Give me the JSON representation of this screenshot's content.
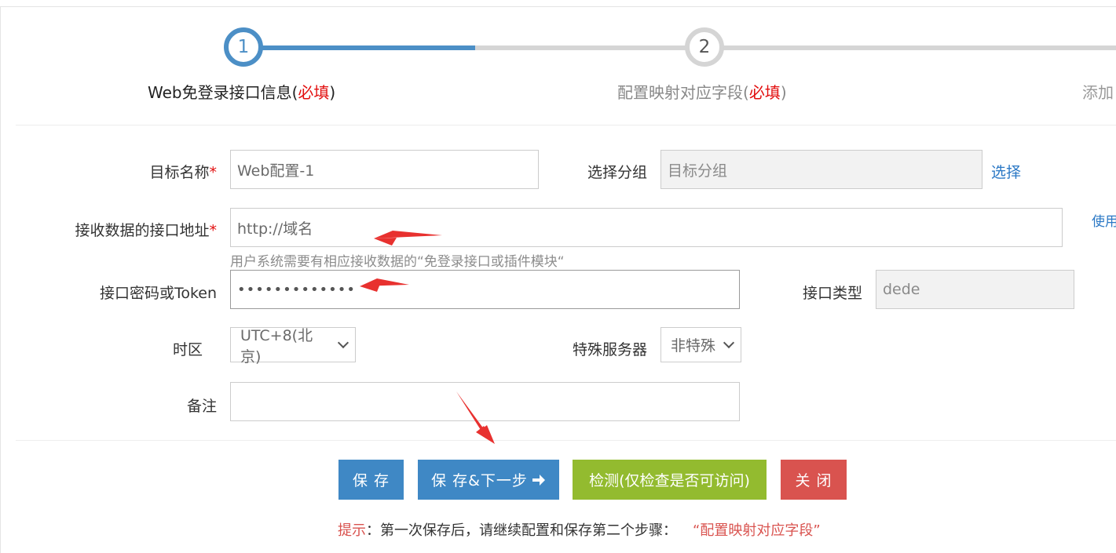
{
  "steps": [
    {
      "number": "1",
      "label": "Web免登录接口信息",
      "required_mark": "必填"
    },
    {
      "number": "2",
      "label": "配置映射对应字段",
      "required_mark": "必填"
    },
    {
      "label": "添加"
    }
  ],
  "paren_open": "(",
  "paren_close": ")",
  "form": {
    "target_name": {
      "label": "目标名称",
      "required": "*",
      "value": "Web配置-1"
    },
    "group": {
      "label": "选择分组",
      "placeholder": "目标分组",
      "select_link": "选择"
    },
    "api_url": {
      "label": "接收数据的接口地址",
      "required": "*",
      "value": "http://域名",
      "side_link": "使用",
      "hint": "用户系统需要有相应接收数据的“免登录接口或插件模块“"
    },
    "token": {
      "label": "接口密码或Token",
      "value": "•••••••••••••"
    },
    "api_type": {
      "label": "接口类型",
      "value": "dede"
    },
    "timezone": {
      "label": "时区",
      "value": "UTC+8(北京)"
    },
    "special_server": {
      "label": "特殊服务器",
      "value": "非特殊"
    },
    "remark": {
      "label": "备注",
      "value": ""
    }
  },
  "buttons": {
    "save": "保 存",
    "save_next": "保 存&下一步",
    "check": "检测(仅检查是否可访问)",
    "close": "关 闭"
  },
  "tip": {
    "prefix": "提示",
    "body": "：第一次保存后，请继续配置和保存第二个步骤：",
    "highlight": "“配置映射对应字段”"
  },
  "colors": {
    "step_active": "#4c8fc6",
    "step_inactive": "#d5d5d5",
    "btn_blue": "#3f88c5",
    "btn_green": "#93bb2f",
    "btn_red": "#d9534f",
    "annotation_red": "#e8312f"
  }
}
